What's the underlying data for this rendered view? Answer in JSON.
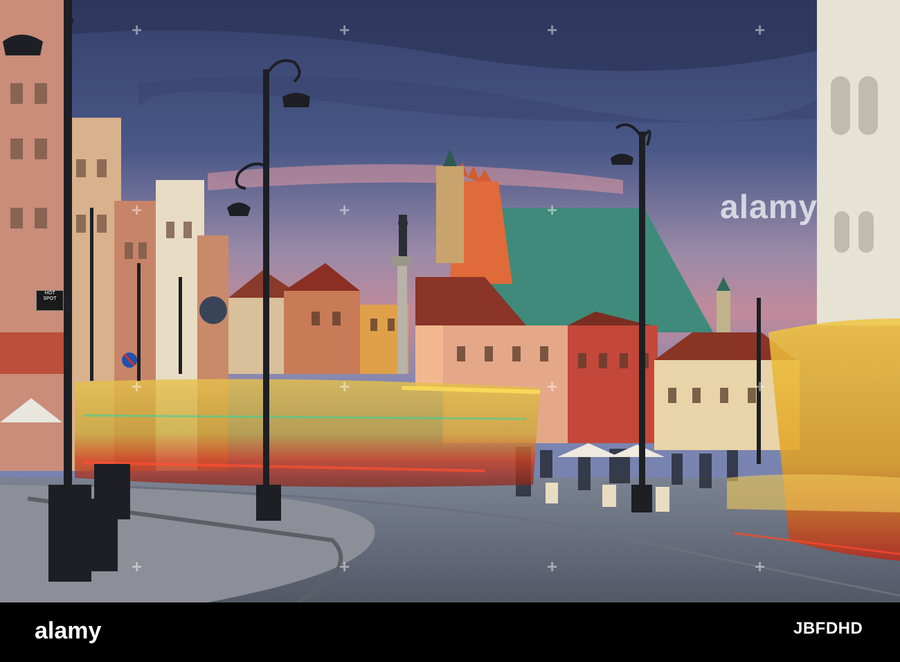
{
  "photo": {
    "description_icon": "city-square-photo",
    "colors": {
      "sky_top": "#3f4f7e",
      "sky_glow": "#d8888f",
      "pavement": "#6f7687",
      "tram_yellow": "#f3c21d",
      "tram_red": "#d12e1c"
    }
  },
  "signs": {
    "hotspot_line1": "HOT",
    "hotspot_line2": "SPOT"
  },
  "watermark": {
    "center_text": "alamy",
    "repeat_mark": "+"
  },
  "footer": {
    "logo_text": "alamy",
    "image_id": "JBFDHD"
  }
}
